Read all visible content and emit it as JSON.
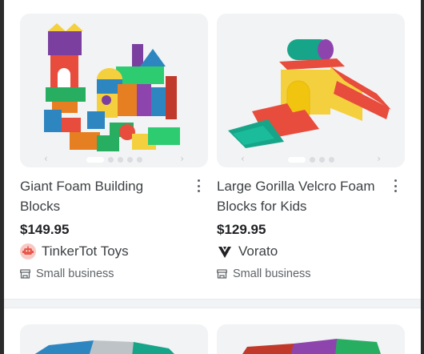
{
  "products": [
    {
      "title": "Giant Foam Building Blocks",
      "price": "$149.95",
      "seller": "TinkerTot Toys",
      "seller_logo_icon": "toy-robot-icon",
      "badge": "Small business",
      "image_dots": 5,
      "active_dot": 0
    },
    {
      "title": "Large Gorilla Velcro Foam Blocks for Kids",
      "price": "$129.95",
      "seller": "Vorato",
      "seller_logo_icon": "vorato-v-icon",
      "badge": "Small business",
      "image_dots": 4,
      "active_dot": 0
    }
  ],
  "colors": {
    "card_bg": "#f1f3f4",
    "price": "#202124",
    "badge_text": "#5f6368",
    "tinkertot_logo": "#f28b82"
  }
}
